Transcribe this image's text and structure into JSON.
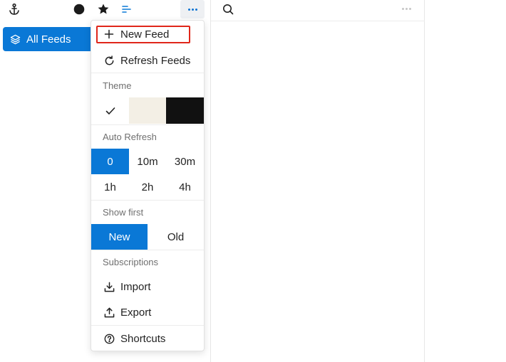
{
  "toolbar": {
    "icons": [
      "anchor-icon",
      "circle-icon",
      "star-icon",
      "filter-lines-icon",
      "more-dots-icon"
    ]
  },
  "sidebar": {
    "all_feeds_label": "All Feeds"
  },
  "menu": {
    "new_feed": "New Feed",
    "refresh_feeds": "Refresh Feeds",
    "theme_heading": "Theme",
    "theme_options": [
      "light",
      "sepia",
      "dark"
    ],
    "theme_selected": "light",
    "theme_colors": {
      "light": "#ffffff",
      "sepia": "#f3efe5",
      "dark": "#111111"
    },
    "auto_refresh_heading": "Auto Refresh",
    "auto_refresh_options": [
      "0",
      "10m",
      "30m",
      "1h",
      "2h",
      "4h"
    ],
    "auto_refresh_selected": "0",
    "show_first_heading": "Show first",
    "show_first_options": [
      "New",
      "Old"
    ],
    "show_first_selected": "New",
    "subscriptions_heading": "Subscriptions",
    "import_label": "Import",
    "export_label": "Export",
    "shortcuts_label": "Shortcuts"
  },
  "colors": {
    "accent": "#0a78d6",
    "highlight_border": "#e0261a"
  }
}
